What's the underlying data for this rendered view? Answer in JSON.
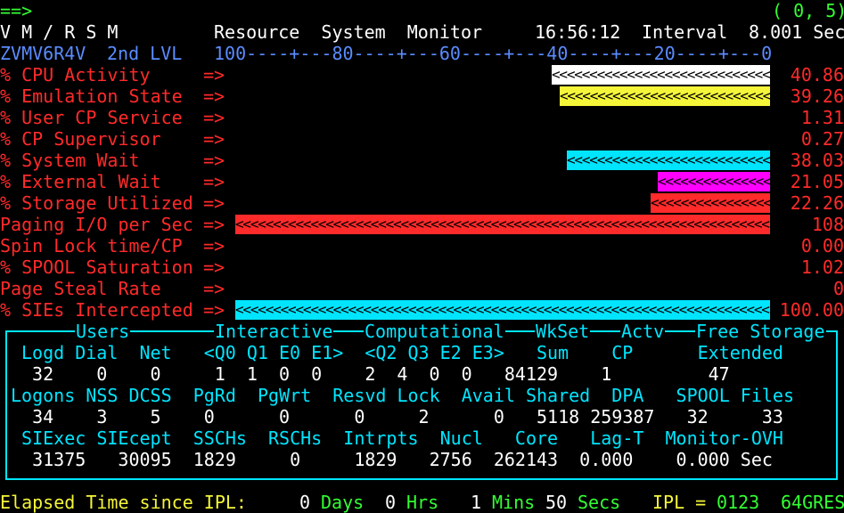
{
  "command_line": {
    "prompt": "==>",
    "cursor": "( 0, 5)"
  },
  "title": {
    "app": "V M / R S M",
    "name": "Resource  System  Monitor",
    "time": "16:56:12",
    "interval_label": "Interval",
    "interval_value": "8.001 Sec"
  },
  "subtitle": {
    "system": "ZVMV6R4V",
    "level": "2nd LVL",
    "scale": "100----+---80----+---60----+---40----+---20----+---0"
  },
  "colors": {
    "white": "#ffffff",
    "yellow": "#f5f53a",
    "cyan": "#00e5ff",
    "magenta": "#ff00ff",
    "red": "#ff2a2a",
    "green": "#33ff33",
    "blue": "#5a8cff"
  },
  "metrics": [
    {
      "label": "% CPU Activity",
      "arrow": "=>",
      "value": "40.86",
      "bar_fraction": 0.4086,
      "bar_color": "white"
    },
    {
      "label": "% Emulation State",
      "arrow": "=>",
      "value": "39.26",
      "bar_fraction": 0.3926,
      "bar_color": "yellow"
    },
    {
      "label": "% User CP Service",
      "arrow": "=>",
      "value": "1.31",
      "bar_fraction": 0,
      "bar_color": "none"
    },
    {
      "label": "% CP Supervisor",
      "arrow": "=>",
      "value": "0.27",
      "bar_fraction": 0,
      "bar_color": "none"
    },
    {
      "label": "% System Wait",
      "arrow": "=>",
      "value": "38.03",
      "bar_fraction": 0.3803,
      "bar_color": "cyan"
    },
    {
      "label": "% External Wait",
      "arrow": "=>",
      "value": "21.05",
      "bar_fraction": 0.2105,
      "bar_color": "magenta"
    },
    {
      "label": "% Storage Utilized",
      "arrow": "=>",
      "value": "22.26",
      "bar_fraction": 0.2226,
      "bar_color": "red"
    },
    {
      "label": "Paging I/O per Sec",
      "arrow": "=>",
      "value": "108",
      "bar_fraction": 1.0,
      "bar_color": "red"
    },
    {
      "label": "Spin Lock time/CP",
      "arrow": "=>",
      "value": "0.00",
      "bar_fraction": 0,
      "bar_color": "none"
    },
    {
      "label": "% SPOOL Saturation",
      "arrow": "=>",
      "value": "1.02",
      "bar_fraction": 0,
      "bar_color": "none"
    },
    {
      "label": "Page Steal Rate",
      "arrow": "=>",
      "value": "0",
      "bar_fraction": 0,
      "bar_color": "none"
    },
    {
      "label": "% SIEs Intercepted",
      "arrow": "=>",
      "value": "100.00",
      "bar_fraction": 1.0,
      "bar_color": "cyan"
    }
  ],
  "panel": {
    "headers": {
      "users": "Users",
      "interactive": "Interactive",
      "computational": "Computational",
      "wkset": "WkSet",
      "actv": "Actv",
      "free_storage": "Free Storage"
    },
    "row1_labels": "Logd Dial  Net   <Q0 Q1 E0 E1>  <Q2 Q3 E2 E3>   Sum    CP      Extended",
    "row1_values": " 32    0    0     1  1  0  0    2  4  0  0   84129    1         47",
    "row2_labels": "Logons NSS DCSS  PgRd  PgWrt  Resvd Lock  Avail Shared  DPA   SPOOL Files",
    "row2_values": "  34    3    5    0      0      0     2      0   5118 259387   32     33",
    "row3_labels": " SIExec SIEcept  SSCHs  RSCHs  Intrpts  Nucl   Core   Lag-T  Monitor-OVH",
    "row3_values": "  31375   30095  1829     0     1829   2756  262143  0.000    0.000 Sec"
  },
  "footer": {
    "label": "Elapsed Time since IPL:",
    "days_value": "0",
    "days_unit": "Days",
    "hrs_value": "0",
    "hrs_unit": "Hrs",
    "mins_value": "1",
    "mins_unit": "Mins",
    "secs_value": "50",
    "secs_unit": "Secs",
    "ipl_label": "IPL =",
    "ipl_value": "0123",
    "storage": "64GRES"
  }
}
